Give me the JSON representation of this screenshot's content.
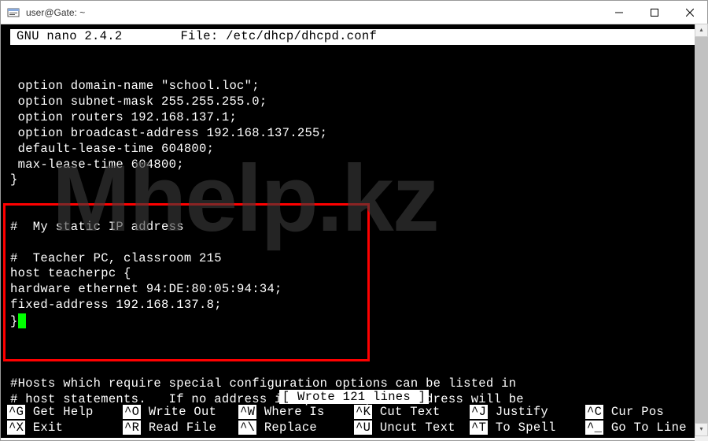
{
  "window": {
    "title": "user@Gate: ~"
  },
  "nano": {
    "app_name": "GNU nano",
    "version": "2.4.2",
    "file_label": "File:",
    "file_path": "/etc/dhcp/dhcpd.conf",
    "status_message": "[ Wrote 121 lines ]"
  },
  "content": {
    "line1": "",
    "line2": " option domain-name \"school.loc\";",
    "line3": " option subnet-mask 255.255.255.0;",
    "line4": " option routers 192.168.137.1;",
    "line5": " option broadcast-address 192.168.137.255;",
    "line6": " default-lease-time 604800;",
    "line7": " max-lease-time 604800;",
    "line8": "}",
    "line9": "",
    "line10": "",
    "line11": "#  My static IP address",
    "line12": "",
    "line13": "#  Teacher PC, classroom 215",
    "line14": "host teacherpc {",
    "line15": "hardware ethernet 94:DE:80:05:94:34;",
    "line16": "fixed-address 192.168.137.8;",
    "line17": "}",
    "line18": "",
    "line19": "",
    "line20": "",
    "line21": "#Hosts which require special configuration options can be listed in",
    "line22": "# host statements.   If no address is specified, the address will be"
  },
  "footer": {
    "row1": {
      "k1": "^G",
      "l1": "Get Help",
      "k2": "^O",
      "l2": "Write Out",
      "k3": "^W",
      "l3": "Where Is",
      "k4": "^K",
      "l4": "Cut Text",
      "k5": "^J",
      "l5": "Justify",
      "k6": "^C",
      "l6": "Cur Pos"
    },
    "row2": {
      "k1": "^X",
      "l1": "Exit",
      "k2": "^R",
      "l2": "Read File",
      "k3": "^\\",
      "l3": "Replace",
      "k4": "^U",
      "l4": "Uncut Text",
      "k5": "^T",
      "l5": "To Spell",
      "k6": "^_",
      "l6": "Go To Line"
    }
  },
  "watermark": "Mhelp.kz"
}
